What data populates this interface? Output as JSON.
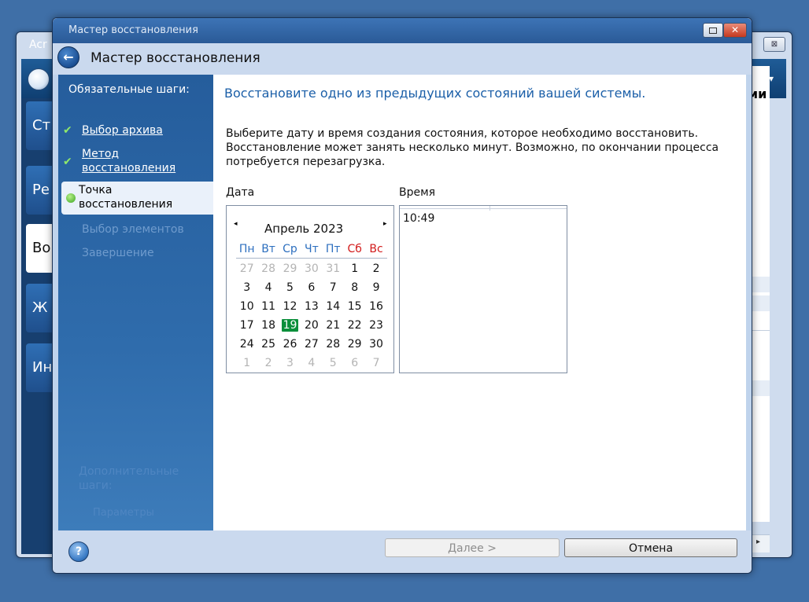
{
  "background_app": {
    "title": "Acr",
    "close_glyph": "⊠",
    "sidebar_tiles": [
      "Ст",
      "Ре",
      "Во",
      "Ж",
      "Ин"
    ],
    "right_text": "ми",
    "scroll_arrow": "▸"
  },
  "wizard": {
    "window_title": "Мастер восстановления",
    "header_title": "Мастер восстановления",
    "close_glyph": "✕",
    "back_glyph": "←",
    "steps_title": "Обязательные шаги:",
    "steps": [
      {
        "label": "Выбор архива",
        "state": "done"
      },
      {
        "label": "Метод восстановления",
        "state": "done"
      },
      {
        "label": "Точка восстановления",
        "state": "current"
      },
      {
        "label": "Выбор элементов",
        "state": "disabled"
      },
      {
        "label": "Завершение",
        "state": "disabled"
      }
    ],
    "check_glyph": "✔",
    "extra_title": "Дополнительные шаги:",
    "extra_params": "Параметры",
    "main_title": "Восстановите одно из предыдущих состояний вашей системы.",
    "instruction": "Выберите дату и время создания состояния, которое необходимо восстановить. Восстановление может занять несколько минут. Возможно, по окончании процесса потребуется перезагрузка.",
    "date_label": "Дата",
    "time_label": "Время",
    "calendar": {
      "prev_glyph": "◂",
      "next_glyph": "▸",
      "month": "Апрель 2023",
      "weekdays": [
        "Пн",
        "Вт",
        "Ср",
        "Чт",
        "Пт",
        "Сб",
        "Вс"
      ],
      "weeks": [
        [
          "27",
          "28",
          "29",
          "30",
          "31",
          "1",
          "2"
        ],
        [
          "3",
          "4",
          "5",
          "6",
          "7",
          "8",
          "9"
        ],
        [
          "10",
          "11",
          "12",
          "13",
          "14",
          "15",
          "16"
        ],
        [
          "17",
          "18",
          "19",
          "20",
          "21",
          "22",
          "23"
        ],
        [
          "24",
          "25",
          "26",
          "27",
          "28",
          "29",
          "30"
        ],
        [
          "1",
          "2",
          "3",
          "4",
          "5",
          "6",
          "7"
        ]
      ],
      "selected": "19",
      "selected_color": "#0b8f3b"
    },
    "time_value": "10:49",
    "help_glyph": "?",
    "next_button": "Далее >",
    "cancel_button": "Отмена"
  },
  "colors": {
    "desktop": "#3f6fa7",
    "accent_title": "#1b5fa8",
    "weekend": "#d21a1a"
  }
}
